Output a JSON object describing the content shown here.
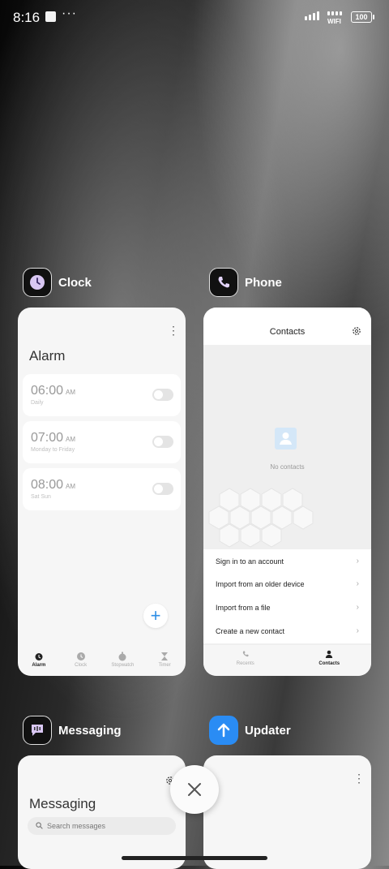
{
  "status_bar": {
    "time": "8:16",
    "dots": "···",
    "wifi": "WIFI",
    "battery": "100"
  },
  "apps": {
    "clock": {
      "name": "Clock",
      "title": "Alarm",
      "alarms": [
        {
          "time": "06:00",
          "ampm": "AM",
          "repeat": "Daily",
          "enabled": false
        },
        {
          "time": "07:00",
          "ampm": "AM",
          "repeat": "Monday to Friday",
          "enabled": false
        },
        {
          "time": "08:00",
          "ampm": "AM",
          "repeat": "Sat Sun",
          "enabled": false
        }
      ],
      "fab": "+",
      "nav": [
        "Alarm",
        "Clock",
        "Stopwatch",
        "Timer"
      ],
      "active_tab": "Alarm"
    },
    "phone": {
      "name": "Phone",
      "title": "Contacts",
      "empty_text": "No contacts",
      "actions": [
        "Sign in to an account",
        "Import from an older device",
        "Import from a file",
        "Create a new contact"
      ],
      "nav": [
        "Recents",
        "Contacts"
      ],
      "active_tab": "Contacts"
    },
    "messaging": {
      "name": "Messaging",
      "title": "Messaging",
      "search_placeholder": "Search messages"
    },
    "updater": {
      "name": "Updater"
    }
  },
  "colors": {
    "accent_blue": "#2d8ee6",
    "updater_icon": "#2a8cf4",
    "messaging_icon": "#1a1a1a"
  }
}
